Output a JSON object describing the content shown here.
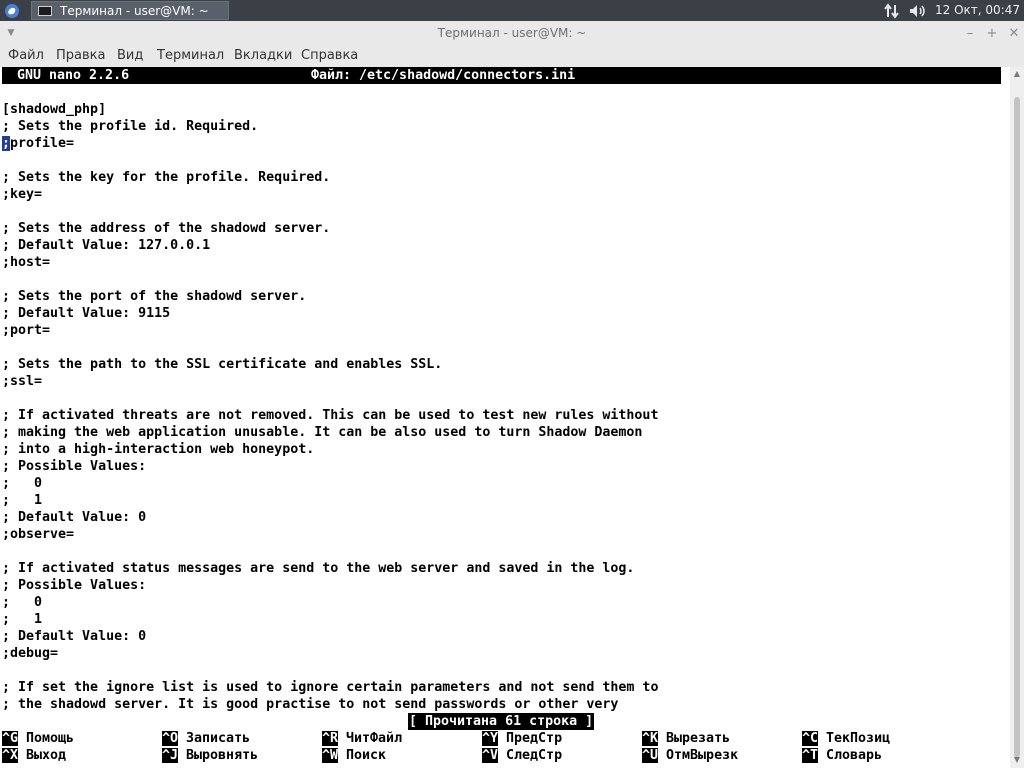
{
  "taskbar": {
    "task_title": "Терминал - user@VM: ~",
    "clock": "12 Окт, 00:47",
    "icons": [
      "app-menu-icon",
      "network-icon",
      "volume-icon"
    ]
  },
  "window": {
    "title": "Терминал - user@VM: ~",
    "menu": [
      "Файл",
      "Правка",
      "Вид",
      "Терминал",
      "Вкладки",
      "Справка"
    ]
  },
  "nano": {
    "version": "GNU nano 2.2.6",
    "file_label": "Файл: /etc/shadowd/connectors.ini",
    "lines": [
      "",
      "[shadowd_php]",
      "; Sets the profile id. Required.",
      ";profile=",
      "",
      "; Sets the key for the profile. Required.",
      ";key=",
      "",
      "; Sets the address of the shadowd server.",
      "; Default Value: 127.0.0.1",
      ";host=",
      "",
      "; Sets the port of the shadowd server.",
      "; Default Value: 9115",
      ";port=",
      "",
      "; Sets the path to the SSL certificate and enables SSL.",
      ";ssl=",
      "",
      "; If activated threats are not removed. This can be used to test new rules without",
      "; making the web application unusable. It can be also used to turn Shadow Daemon",
      "; into a high-interaction web honeypot.",
      "; Possible Values:",
      ";   0",
      ";   1",
      "; Default Value: 0",
      ";observe=",
      "",
      "; If activated status messages are send to the web server and saved in the log.",
      "; Possible Values:",
      ";   0",
      ";   1",
      "; Default Value: 0",
      ";debug=",
      "",
      "; If set the ignore list is used to ignore certain parameters and not send them to",
      "; the shadowd server. It is good practise to not send passwords or other very"
    ],
    "status": "[ Прочитана 61 строка ]",
    "shortcuts": [
      {
        "key": "^G",
        "label": "Помощь"
      },
      {
        "key": "^O",
        "label": "Записать"
      },
      {
        "key": "^R",
        "label": "ЧитФайл"
      },
      {
        "key": "^Y",
        "label": "ПредСтр"
      },
      {
        "key": "^K",
        "label": "Вырезать"
      },
      {
        "key": "^C",
        "label": "ТекПозиц"
      },
      {
        "key": "^X",
        "label": "Выход"
      },
      {
        "key": "^J",
        "label": "Выровнять"
      },
      {
        "key": "^W",
        "label": "Поиск"
      },
      {
        "key": "^V",
        "label": "СледСтр"
      },
      {
        "key": "^U",
        "label": "ОтмВырезк"
      },
      {
        "key": "^T",
        "label": "Словарь"
      }
    ]
  }
}
